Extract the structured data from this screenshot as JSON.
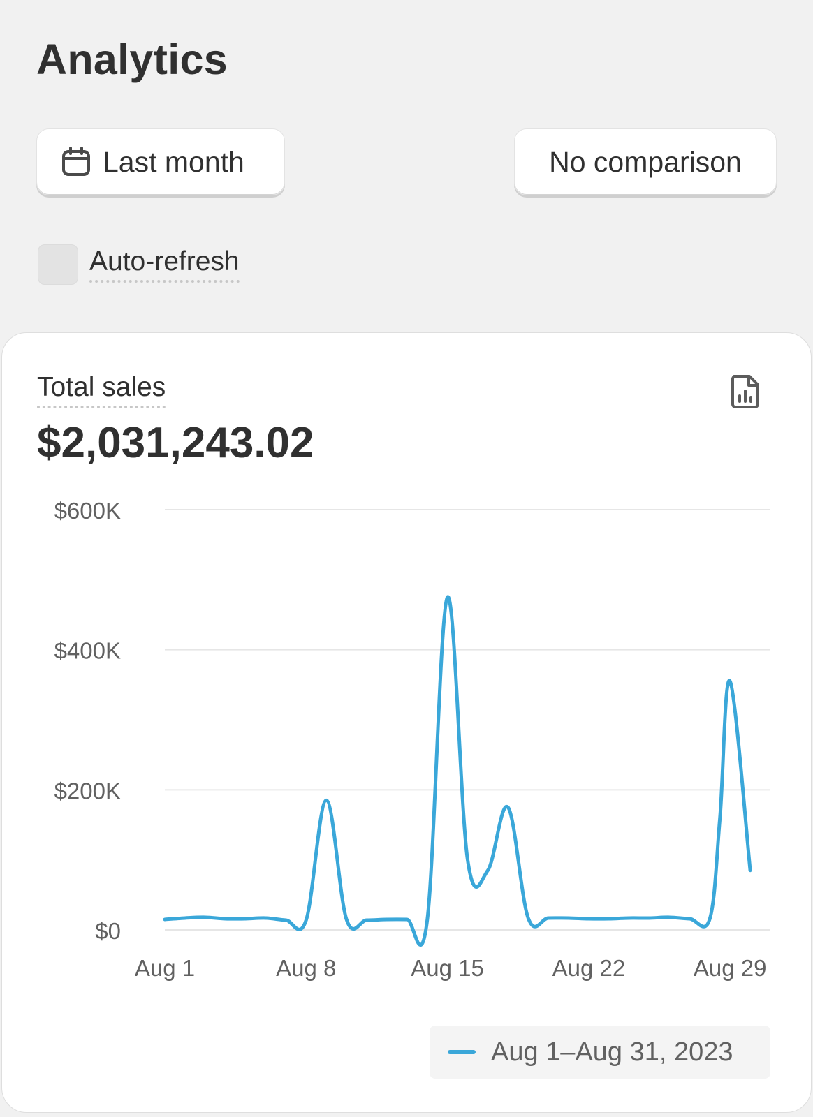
{
  "header": {
    "title": "Analytics"
  },
  "filters": {
    "period_label": "Last month",
    "comparison_label": "No comparison",
    "auto_refresh_label": "Auto-refresh",
    "auto_refresh_checked": false
  },
  "card": {
    "metric_label": "Total sales",
    "metric_value": "$2,031,243.02",
    "export_icon": "report-chart-icon"
  },
  "colors": {
    "series": "#3aa7d9",
    "gridline": "#e6e6e6",
    "axis_text": "#616161"
  },
  "chart_data": {
    "type": "line",
    "title": "",
    "xlabel": "",
    "ylabel": "",
    "ylim": [
      0,
      600000
    ],
    "y_ticks": [
      0,
      200000,
      400000,
      600000
    ],
    "y_tick_labels": [
      "$0",
      "$200K",
      "$400K",
      "$600K"
    ],
    "x_tick_labels": [
      "Aug 1",
      "Aug 8",
      "Aug 15",
      "Aug 22",
      "Aug 29"
    ],
    "x_tick_days": [
      1,
      8,
      15,
      22,
      29
    ],
    "grid": true,
    "legend_position": "bottom-right",
    "x": [
      1,
      2,
      3,
      4,
      5,
      6,
      7,
      8,
      9,
      10,
      11,
      12,
      13,
      14,
      15,
      16,
      17,
      18,
      19,
      20,
      21,
      22,
      23,
      24,
      25,
      26,
      27,
      28,
      28.5,
      29,
      30,
      31
    ],
    "series": [
      {
        "name": "Aug 1–Aug 31, 2023",
        "values": [
          15000,
          17000,
          18000,
          16000,
          16000,
          17000,
          14000,
          14000,
          185000,
          15000,
          14000,
          15000,
          15000,
          14000,
          475000,
          100000,
          85000,
          175000,
          17000,
          17000,
          17000,
          16000,
          16000,
          17000,
          17000,
          18000,
          16000,
          16000,
          160000,
          355000,
          85000
        ]
      }
    ]
  }
}
